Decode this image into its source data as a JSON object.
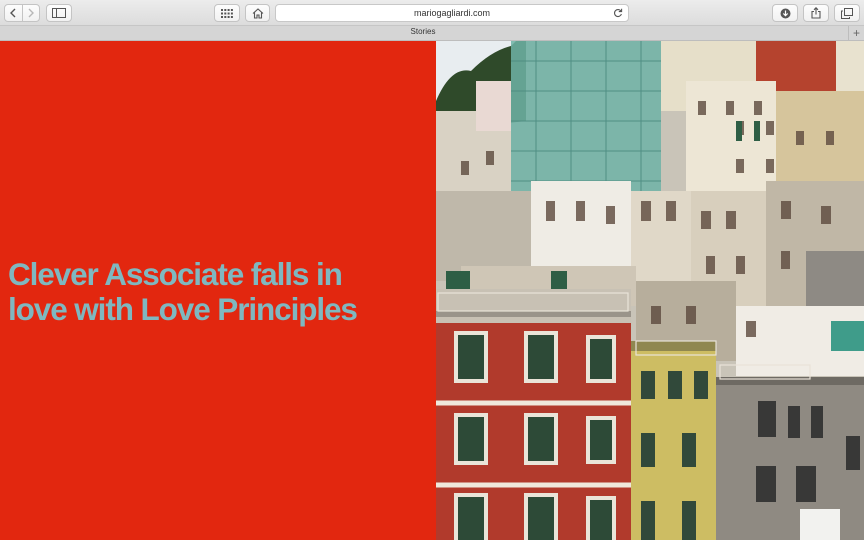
{
  "browser": {
    "url": "mariogagliardi.com",
    "tab_title": "Stories",
    "new_tab_symbol": "+"
  },
  "toolbar_icons": {
    "back": "chevron-left-icon",
    "forward": "chevron-right-icon",
    "sidebar": "sidebar-icon",
    "top_sites": "grid-icon",
    "home": "home-icon",
    "reload": "reload-icon",
    "downloads": "download-icon",
    "share": "share-icon",
    "tabs": "tabs-overview-icon"
  },
  "page": {
    "headline_line1": "Clever Associate falls in",
    "headline_line2": "love with Love Principles",
    "image_description_icon": "colorful-hillside-houses-photo"
  },
  "colors": {
    "panel_red": "#e2270f",
    "headline_teal": "#7fb8c0"
  }
}
